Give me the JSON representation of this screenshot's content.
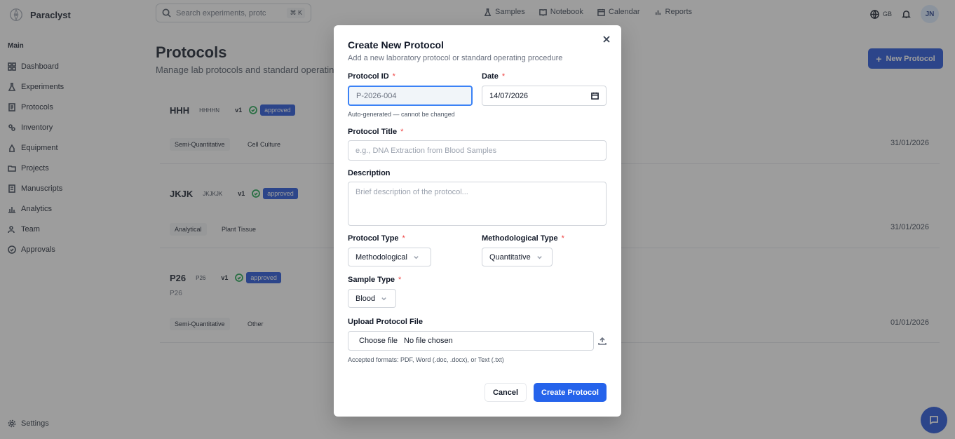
{
  "app": {
    "name": "Paraclyst"
  },
  "sidebar": {
    "section": "Main",
    "items": [
      {
        "label": "Dashboard",
        "icon": "dashboard-icon"
      },
      {
        "label": "Experiments",
        "icon": "flask-icon"
      },
      {
        "label": "Protocols",
        "icon": "document-icon"
      },
      {
        "label": "Inventory",
        "icon": "package-icon"
      },
      {
        "label": "Equipment",
        "icon": "wrench-icon"
      },
      {
        "label": "Projects",
        "icon": "folder-icon"
      },
      {
        "label": "Manuscripts",
        "icon": "file-text-icon"
      },
      {
        "label": "Analytics",
        "icon": "bar-chart-icon"
      },
      {
        "label": "Team",
        "icon": "users-icon"
      },
      {
        "label": "Approvals",
        "icon": "check-circle-icon"
      }
    ],
    "settings": "Settings"
  },
  "topbar": {
    "search_placeholder": "Search experiments, protc",
    "shortcut": "⌘ K",
    "nav": [
      "Samples",
      "Notebook",
      "Calendar",
      "Reports"
    ],
    "language": "GB",
    "avatar": "JN"
  },
  "page": {
    "title": "Protocols",
    "subtitle": "Manage lab protocols and standard operating",
    "new_button": "New Protocol"
  },
  "protocols": [
    {
      "title": "HHH",
      "code": "HHHHN",
      "version": "v1",
      "status": "approved",
      "tags": [
        "Semi-Quantitative",
        "Cell Culture"
      ],
      "date": "31/01/2026",
      "description": ""
    },
    {
      "title": "JKJK",
      "code": "JKJKJK",
      "version": "v1",
      "status": "approved",
      "tags": [
        "Analytical",
        "Plant Tissue"
      ],
      "date": "31/01/2026",
      "description": ""
    },
    {
      "title": "P26",
      "code": "P26",
      "version": "v1",
      "status": "approved",
      "tags": [
        "Semi-Quantitative",
        "Other"
      ],
      "date": "01/01/2026",
      "description": "P26"
    }
  ],
  "modal": {
    "title": "Create New Protocol",
    "subtitle": "Add a new laboratory protocol or standard operating procedure",
    "protocol_id_label": "Protocol ID",
    "protocol_id_value": "P-2026-004",
    "protocol_id_help": "Auto-generated — cannot be changed",
    "date_label": "Date",
    "date_value": "14/07/2026",
    "title_label": "Protocol Title",
    "title_placeholder": "e.g., DNA Extraction from Blood Samples",
    "description_label": "Description",
    "description_placeholder": "Brief description of the protocol...",
    "protocol_type_label": "Protocol Type",
    "protocol_type_value": "Methodological",
    "method_type_label": "Methodological Type",
    "method_type_value": "Quantitative",
    "sample_type_label": "Sample Type",
    "sample_type_value": "Blood",
    "upload_label": "Upload Protocol File",
    "choose_file": "Choose file",
    "no_file": "No file chosen",
    "upload_help": "Accepted formats: PDF, Word (.doc, .docx), or Text (.txt)",
    "cancel": "Cancel",
    "create": "Create Protocol",
    "required_mark": "*"
  }
}
